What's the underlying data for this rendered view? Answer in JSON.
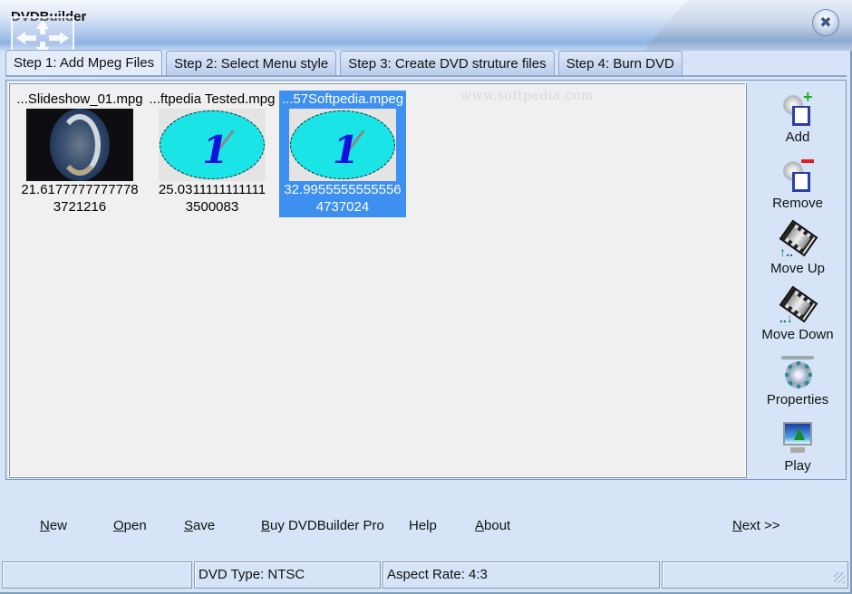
{
  "window": {
    "title": "DVDBuilder",
    "close_icon": "close-icon"
  },
  "tabs": [
    {
      "label": "Step 1: Add Mpeg Files",
      "active": true
    },
    {
      "label": "Step 2: Select Menu style",
      "active": false
    },
    {
      "label": "Step 3: Create DVD struture files",
      "active": false
    },
    {
      "label": "Step 4: Burn DVD",
      "active": false
    }
  ],
  "watermark": "www.softpedia.com",
  "files": [
    {
      "name": "...Slideshow_01.mpg",
      "duration": "21.6177777777778",
      "size": "3721216",
      "thumbnail": "slideshow-globe",
      "selected": false
    },
    {
      "name": "...ftpedia Tested.mpg",
      "duration": "25.0311111111111",
      "size": "3500083",
      "thumbnail": "clock",
      "selected": false
    },
    {
      "name": "...57Softpedia.mpeg",
      "duration": "32.9955555555556",
      "size": "4737024",
      "thumbnail": "clock",
      "selected": true
    }
  ],
  "toolbar": [
    {
      "label": "Add",
      "icon": "add-file-icon"
    },
    {
      "label": "Remove",
      "icon": "remove-file-icon"
    },
    {
      "label": "Move Up",
      "icon": "move-up-film-icon"
    },
    {
      "label": "Move Down",
      "icon": "move-down-film-icon"
    },
    {
      "label": "Properties",
      "icon": "properties-gear-icon"
    },
    {
      "label": "Play",
      "icon": "play-monitor-icon"
    }
  ],
  "bottom_links": {
    "new": {
      "accel": "N",
      "rest": "ew"
    },
    "open": {
      "accel": "O",
      "rest": "pen"
    },
    "save": {
      "accel": "S",
      "rest": "ave"
    },
    "buy": {
      "accel": "B",
      "rest": "uy DVDBuilder Pro"
    },
    "help": {
      "accel": "",
      "rest": "Help"
    },
    "about": {
      "accel": "A",
      "rest": "bout"
    },
    "next": {
      "accel": "N",
      "rest": "ext >>"
    }
  },
  "status": {
    "cell1": "",
    "dvd_type": "DVD Type: NTSC",
    "aspect_rate": "Aspect Rate: 4:3",
    "cell4": ""
  },
  "colors": {
    "selection": "#3d8ff0",
    "window_bg": "#d7e4f8",
    "list_bg": "#f0f0f0"
  }
}
